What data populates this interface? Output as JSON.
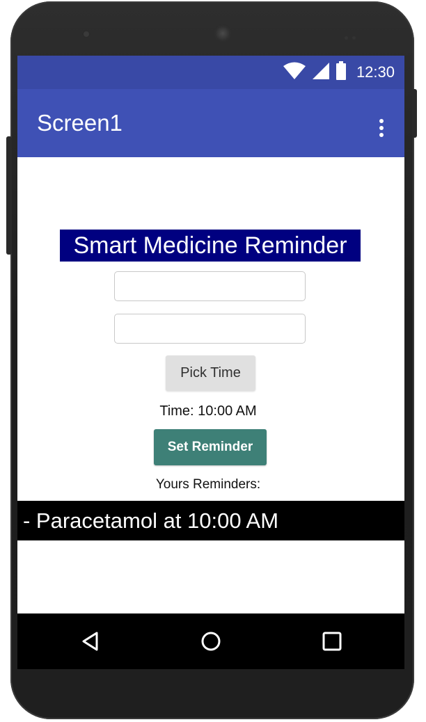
{
  "status_bar": {
    "time": "12:30",
    "icons": [
      "wifi-icon",
      "signal-icon",
      "battery-icon"
    ],
    "color": "#3949a6"
  },
  "app_bar": {
    "title": "Screen1",
    "menu_icon": "overflow-menu-icon",
    "color": "#3f51b5"
  },
  "main": {
    "heading": "Smart Medicine Reminder",
    "heading_bg": "#000080",
    "input_1": {
      "value": "",
      "placeholder": ""
    },
    "input_2": {
      "value": "",
      "placeholder": ""
    },
    "pick_time_label": "Pick Time",
    "time_label": "Time: 10:00 AM",
    "set_reminder_label": "Set Reminder",
    "set_reminder_color": "#3e8077",
    "reminders_label": "Yours Reminders:",
    "reminders": [
      {
        "text": "- Paracetamol at 10:00 AM"
      }
    ]
  },
  "nav_bar": {
    "buttons": [
      "back-icon",
      "home-icon",
      "recents-icon"
    ]
  }
}
